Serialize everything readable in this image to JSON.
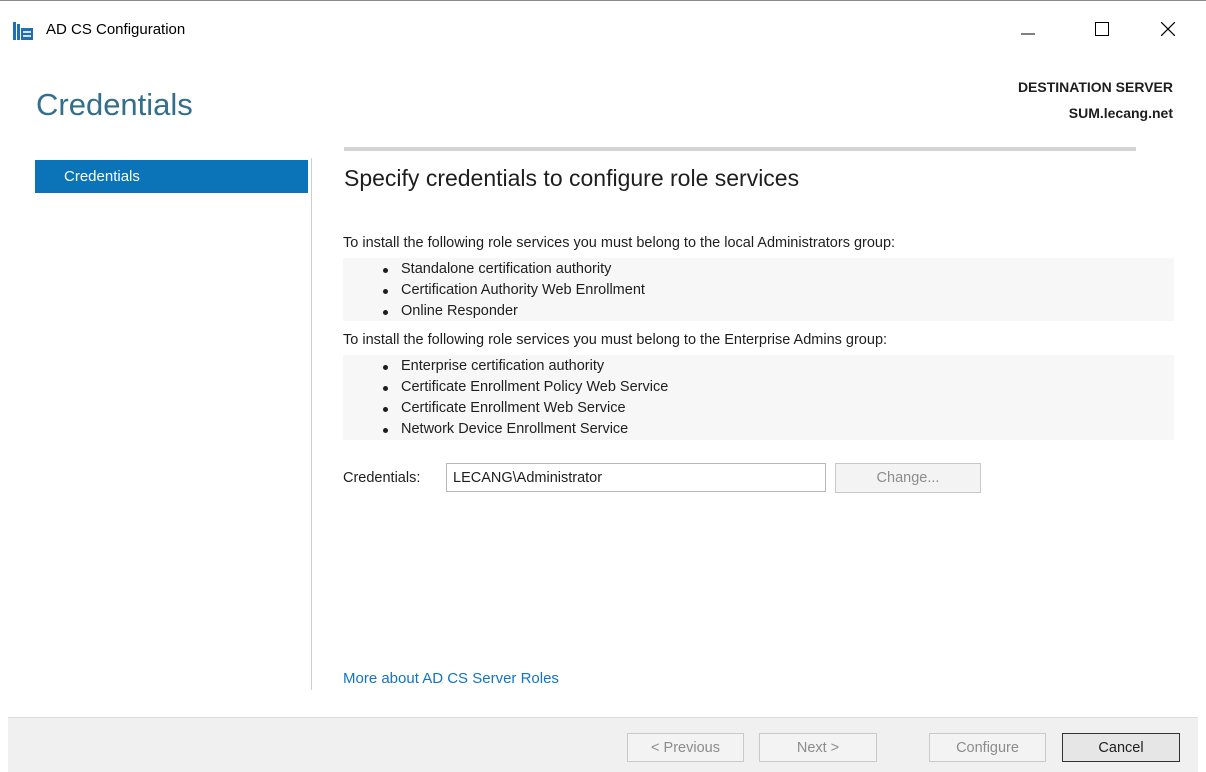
{
  "window": {
    "title": "AD CS Configuration",
    "controls": {
      "minimize_icon": "minimize-icon",
      "maximize_icon": "maximize-icon",
      "close_icon": "close-icon"
    }
  },
  "header": {
    "page_title": "Credentials",
    "destination_label": "DESTINATION SERVER",
    "destination_server": "SUM.lecang.net"
  },
  "sidebar": {
    "items": [
      {
        "label": "Credentials",
        "selected": true
      }
    ]
  },
  "main": {
    "heading": "Specify credentials to configure role services",
    "local_admins_intro": "To install the following role services you must belong to the local Administrators group:",
    "local_admins_roles": [
      "Standalone certification authority",
      "Certification Authority Web Enrollment",
      "Online Responder"
    ],
    "enterprise_admins_intro": "To install the following role services you must belong to the Enterprise Admins group:",
    "enterprise_admins_roles": [
      "Enterprise certification authority",
      "Certificate Enrollment Policy Web Service",
      "Certificate Enrollment Web Service",
      "Network Device Enrollment Service"
    ],
    "credentials_label": "Credentials:",
    "credentials_value": "LECANG\\Administrator",
    "change_button": "Change...",
    "more_link": "More about AD CS Server Roles"
  },
  "footer": {
    "previous": "< Previous",
    "next": "Next >",
    "configure": "Configure",
    "cancel": "Cancel"
  },
  "colors": {
    "accent": "#0b73b8",
    "title": "#336f8c",
    "link": "#1574c1"
  }
}
